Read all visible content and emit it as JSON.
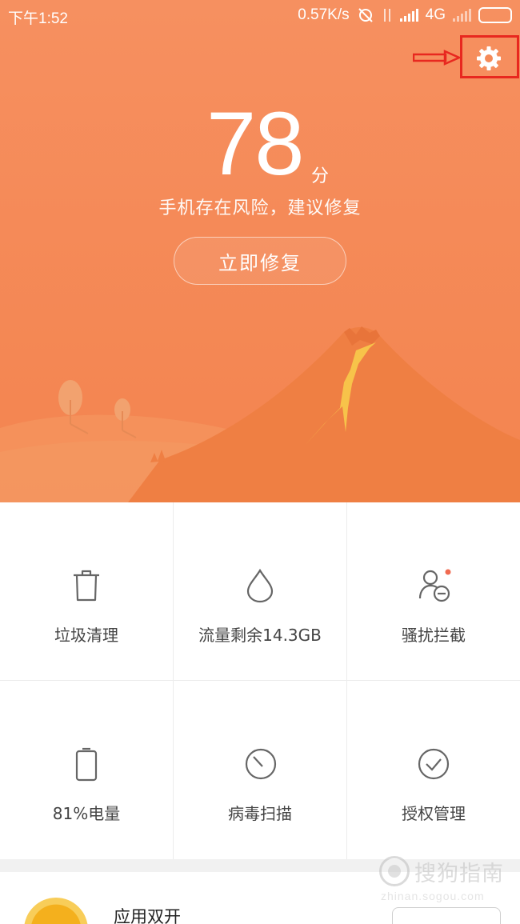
{
  "status_bar": {
    "time": "下午1:52",
    "net_speed": "0.57K/s",
    "network_type": "4G",
    "icons": [
      "sync-off-icon",
      "data-arrows-icon",
      "signal-icon",
      "signal-secondary-icon",
      "battery-icon"
    ]
  },
  "header": {
    "settings_icon": "gear-icon",
    "annotation": "red-arrow-and-box-highlight"
  },
  "score": {
    "value": "78",
    "unit": "分",
    "warning": "手机存在风险，建议修复",
    "fix_button": "立即修复"
  },
  "colors": {
    "hero_orange": "#f58a58",
    "highlight_red": "#e8281f",
    "badge_red": "#f06a50"
  },
  "tools": [
    {
      "label": "垃圾清理",
      "icon": "trash-icon"
    },
    {
      "label": "流量剩余14.3GB",
      "icon": "water-drop-icon"
    },
    {
      "label": "骚扰拦截",
      "icon": "user-block-icon",
      "badge": true
    },
    {
      "label": "81%电量",
      "icon": "battery-outline-icon"
    },
    {
      "label": "病毒扫描",
      "icon": "scan-timer-icon"
    },
    {
      "label": "授权管理",
      "icon": "check-circle-icon"
    }
  ],
  "bottom": {
    "app_title": "应用双开",
    "app_icon": "dual-app-icon",
    "open_button": ""
  },
  "watermark": {
    "text": "搜狗指南",
    "url": "zhinan.sogou.com"
  }
}
